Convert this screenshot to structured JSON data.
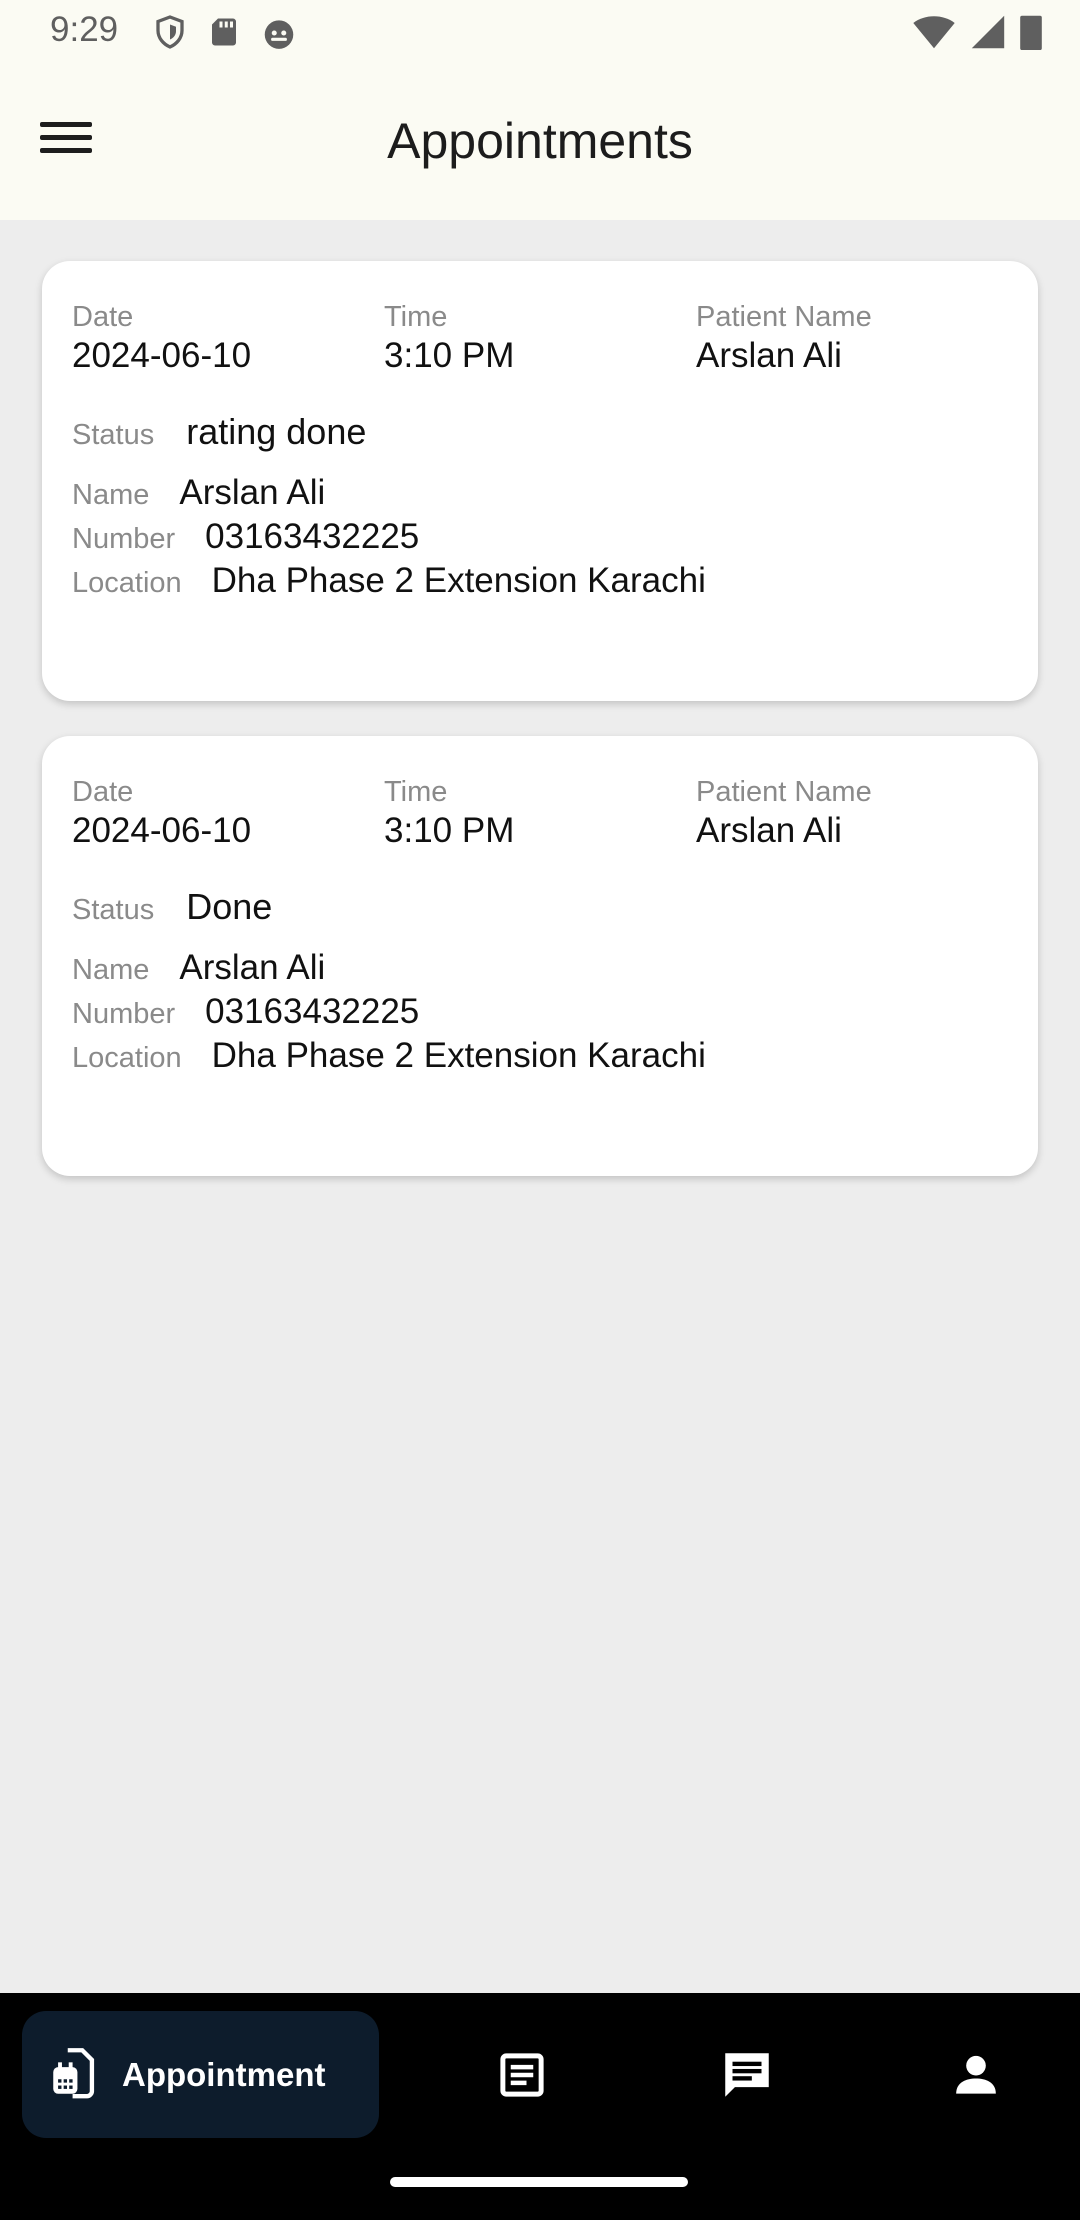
{
  "status_bar": {
    "time": "9:29",
    "icons": [
      "shield-icon",
      "sd-card-icon",
      "android-icon",
      "wifi-icon",
      "signal-icon",
      "battery-icon"
    ]
  },
  "app_bar": {
    "title": "Appointments",
    "menu_icon": "menu-icon"
  },
  "appointments": [
    {
      "date_label": "Date",
      "date": "2024-06-10",
      "time_label": "Time",
      "time": "3:10 PM",
      "patient_label": "Patient Name",
      "patient": "Arslan Ali",
      "status_label": "Status",
      "status": "rating done",
      "name_label": "Name",
      "name": "Arslan Ali",
      "number_label": "Number",
      "number": "03163432225",
      "location_label": "Location",
      "location": "Dha Phase 2 Extension Karachi"
    },
    {
      "date_label": "Date",
      "date": "2024-06-10",
      "time_label": "Time",
      "time": "3:10 PM",
      "patient_label": "Patient Name",
      "patient": "Arslan Ali",
      "status_label": "Status",
      "status": "Done",
      "name_label": "Name",
      "name": "Arslan Ali",
      "number_label": "Number",
      "number": "03163432225",
      "location_label": "Location",
      "location": "Dha Phase 2 Extension Karachi"
    }
  ],
  "bottom_nav": {
    "active_label": "Appointment",
    "active_icon": "appointment-icon",
    "items": [
      "list-icon",
      "chat-icon",
      "profile-icon"
    ],
    "colors": {
      "background": "#000000",
      "active_pill": "#0d1c2c",
      "icon": "#ffffff"
    }
  }
}
